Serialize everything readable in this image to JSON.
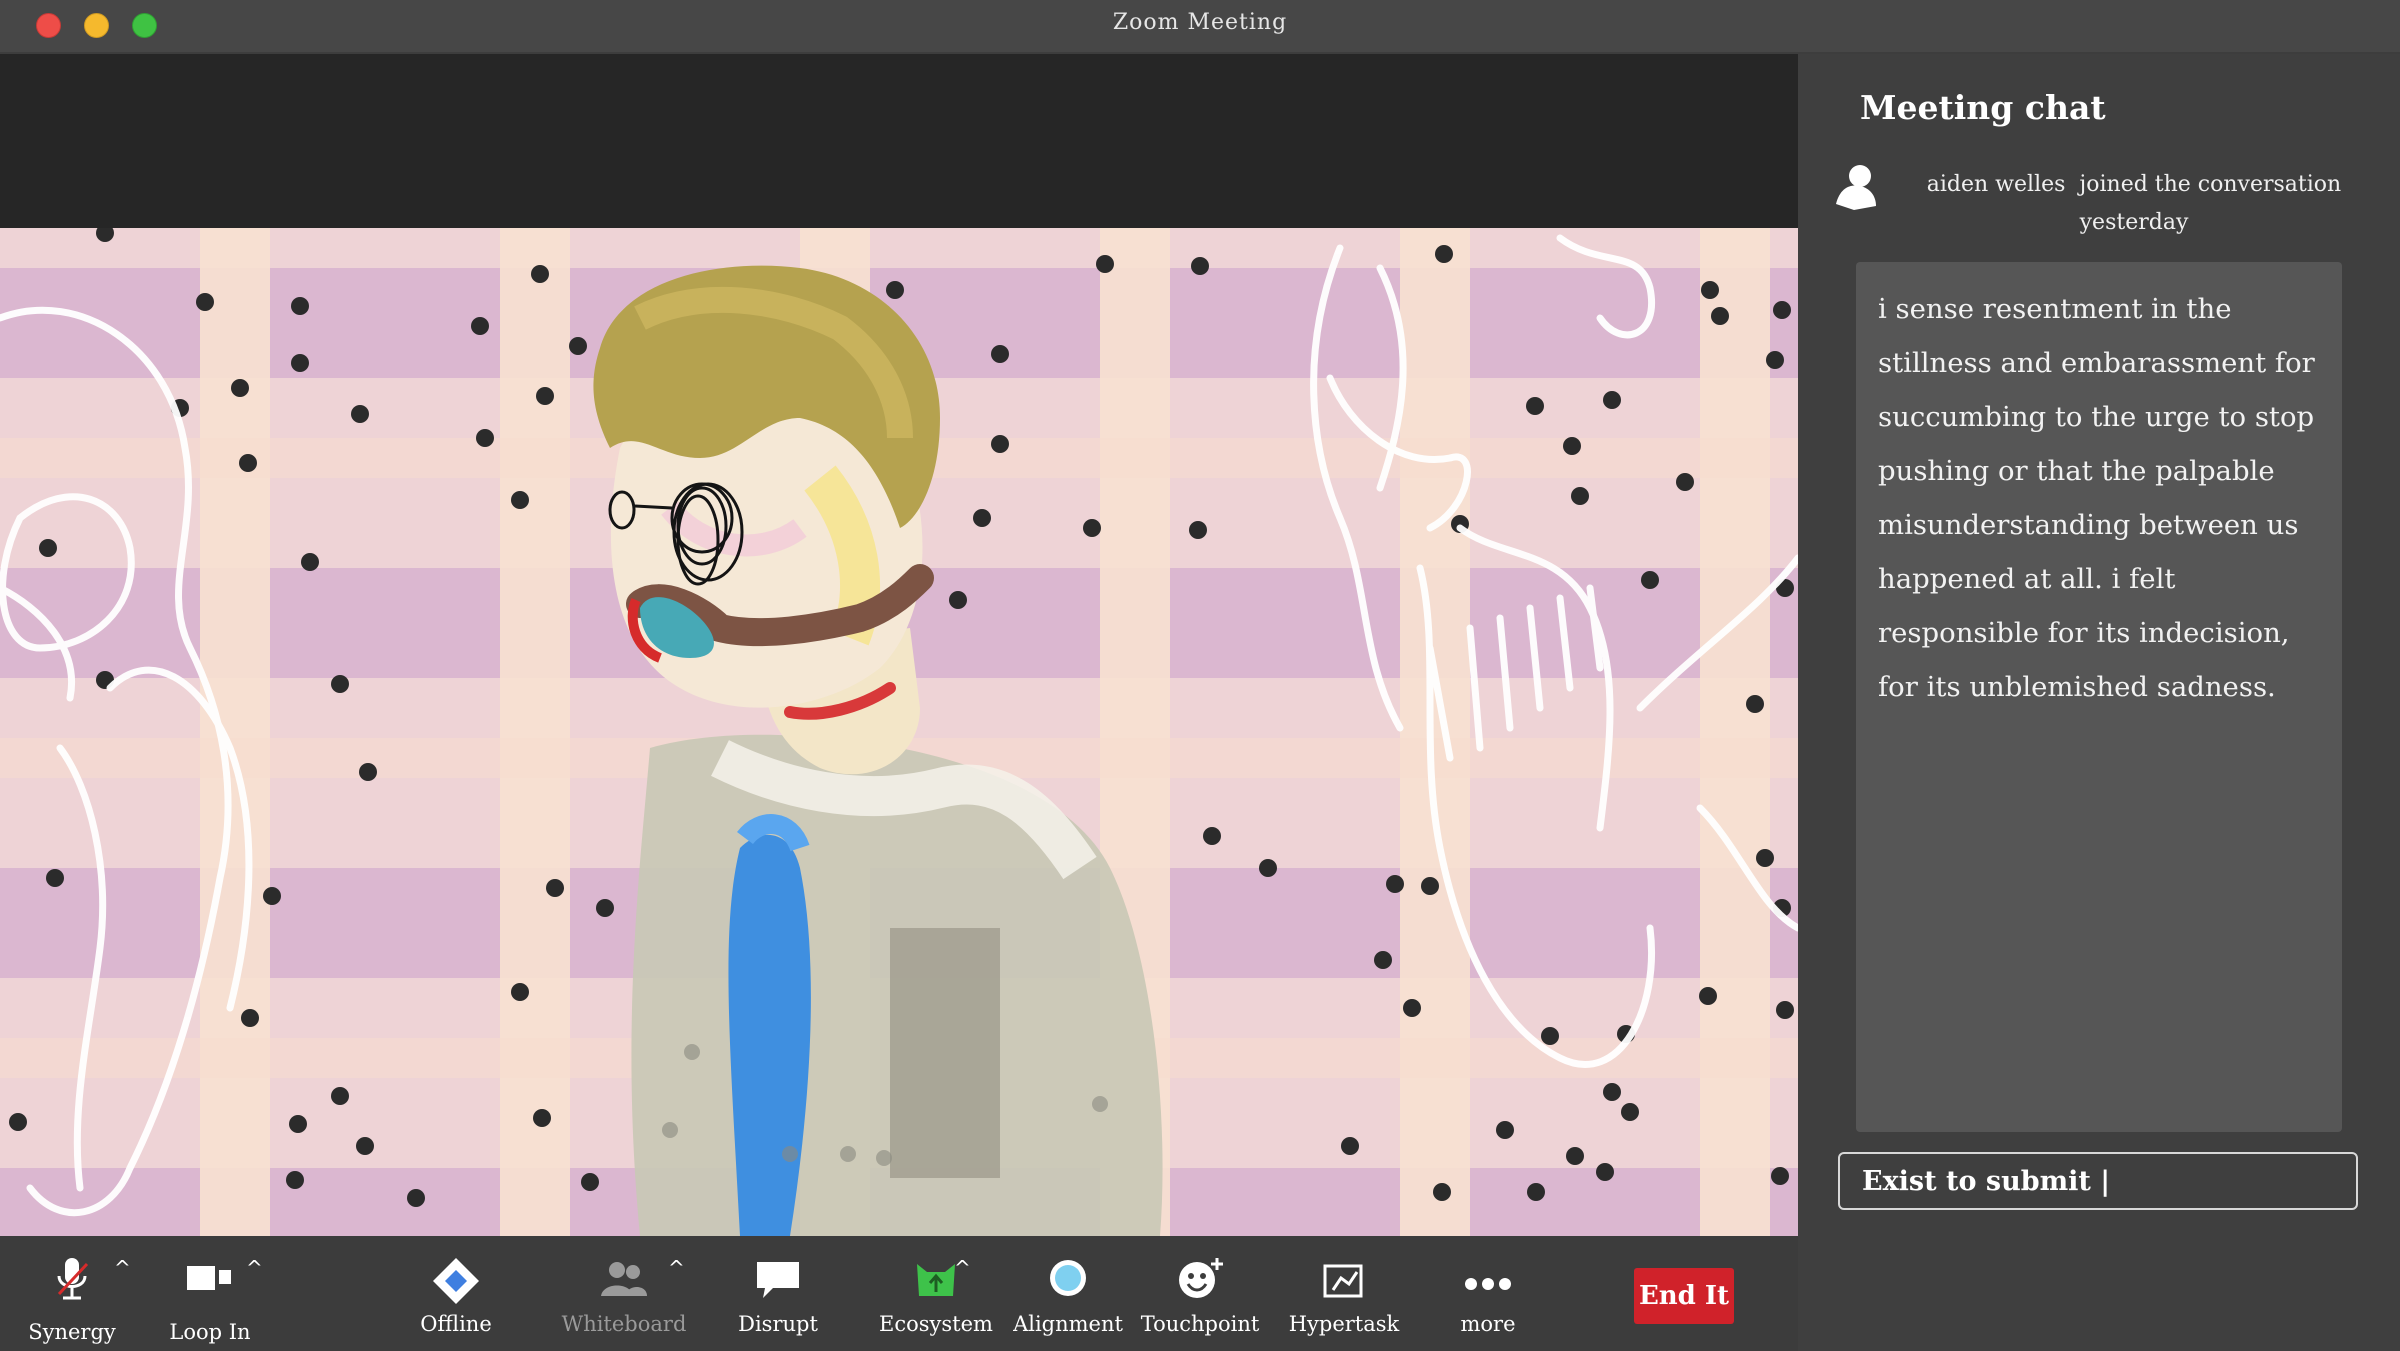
{
  "window": {
    "title": "Zoom Meeting"
  },
  "chat": {
    "title": "Meeting chat",
    "join_user": "aiden welles",
    "join_action": "joined the conversation",
    "join_time": "yesterday",
    "message": "i sense resentment in the stillness and embarassment for succumbing to the urge to stop pushing or that the palpable misunderstanding between us happened at all. i felt responsible for its indecision, for its unblemished sadness.",
    "input_value": "Exist to submit |"
  },
  "toolbar": {
    "synergy": "Synergy",
    "loop_in": "Loop In",
    "offline": "Offline",
    "whiteboard": "Whiteboard",
    "disrupt": "Disrupt",
    "ecosystem": "Ecosystem",
    "alignment": "Alignment",
    "touchpoint": "Touchpoint",
    "hypertask": "Hypertask",
    "more": "more",
    "end": "End It"
  },
  "colors": {
    "end_button": "#d0222a",
    "ecosystem_icon": "#3ec24a",
    "alignment_icon": "#7fd0f0"
  }
}
